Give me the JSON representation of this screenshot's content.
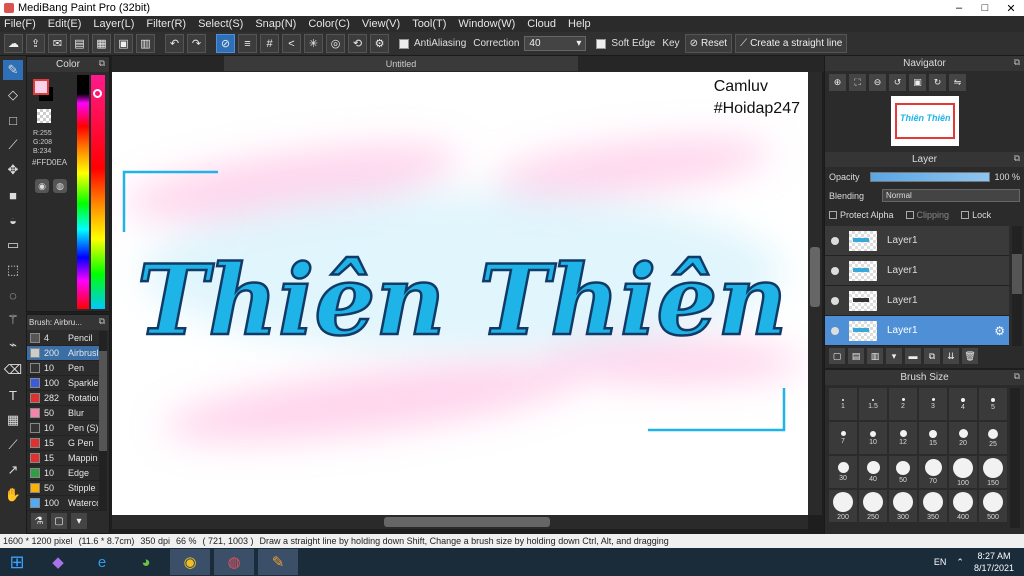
{
  "window": {
    "title": "MediBang Paint Pro (32bit)",
    "controls": [
      "–",
      "□",
      "✕"
    ]
  },
  "menu": [
    "File(F)",
    "Edit(E)",
    "Layer(L)",
    "Filter(R)",
    "Select(S)",
    "Snap(N)",
    "Color(C)",
    "View(V)",
    "Tool(T)",
    "Window(W)",
    "Cloud",
    "Help"
  ],
  "toolbar": {
    "antialiasing_label": "AntiAliasing",
    "correction_label": "Correction",
    "correction_value": "40",
    "soft_edge_label": "Soft Edge",
    "key_label": "Key",
    "reset_label": "Reset",
    "straight_line_label": "Create a straight line"
  },
  "color_panel": {
    "title": "Color",
    "r": "R:255",
    "g": "G:208",
    "b": "B:234",
    "hex": "#FFD0EA",
    "primary_color": "#FFD0EA",
    "secondary_color": "#000000"
  },
  "brush_panel": {
    "title": "Brush: Airbru...",
    "items": [
      {
        "size": "4",
        "name": "Pencil",
        "color": "#555555"
      },
      {
        "size": "200",
        "name": "Airbrush",
        "color": "#cccccc"
      },
      {
        "size": "10",
        "name": "Pen",
        "color": "#333333"
      },
      {
        "size": "100",
        "name": "Sparkle",
        "color": "#3b5bdb"
      },
      {
        "size": "282",
        "name": "Rotation",
        "color": "#e03131"
      },
      {
        "size": "50",
        "name": "Blur",
        "color": "#f783ac"
      },
      {
        "size": "10",
        "name": "Pen (S)",
        "color": "#333333"
      },
      {
        "size": "15",
        "name": "G Pen",
        "color": "#e03131"
      },
      {
        "size": "15",
        "name": "Mapping",
        "color": "#e03131"
      },
      {
        "size": "10",
        "name": "Edge",
        "color": "#2f9e44"
      },
      {
        "size": "50",
        "name": "Stipple",
        "color": "#fab005"
      },
      {
        "size": "100",
        "name": "Watercolor",
        "color": "#4dabf7"
      }
    ]
  },
  "document": {
    "tab_title": "Untitled",
    "lettering": "Thiên Thiên",
    "watermark_line1": "Camluv",
    "watermark_line2": "#Hoidap247"
  },
  "status": {
    "size": "1600 * 1200 pixel",
    "physical": "(11.6 * 8.7cm)",
    "dpi": "350 dpi",
    "zoom": "66 %",
    "coords": "( 721, 1003 )",
    "hint": "Draw a straight line by holding down Shift, Change a brush size by holding down Ctrl, Alt, and dragging"
  },
  "navigator": {
    "title": "Navigator",
    "thumb_text": "Thiên Thiên"
  },
  "layer_panel": {
    "title": "Layer",
    "opacity_label": "Opacity",
    "opacity_value": "100 %",
    "blending_label": "Blending",
    "blending_value": "Normal",
    "protect_alpha": "Protect Alpha",
    "clipping": "Clipping",
    "lock": "Lock",
    "layers": [
      "Layer1",
      "Layer1",
      "Layer1",
      "Layer1"
    ]
  },
  "brush_size": {
    "title": "Brush Size",
    "sizes": [
      "1",
      "1.5",
      "2",
      "3",
      "4",
      "5",
      "7",
      "10",
      "12",
      "15",
      "20",
      "25",
      "30",
      "40",
      "50",
      "70",
      "100",
      "150",
      "200",
      "250",
      "300",
      "350",
      "400",
      "500"
    ]
  },
  "taskbar": {
    "lang": "EN",
    "time": "8:27 AM",
    "date": "8/17/2021"
  },
  "colors": {
    "accent": "#2f6fb5",
    "lettering": "#1eb4e8",
    "selected_layer": "#4f8fd6"
  }
}
